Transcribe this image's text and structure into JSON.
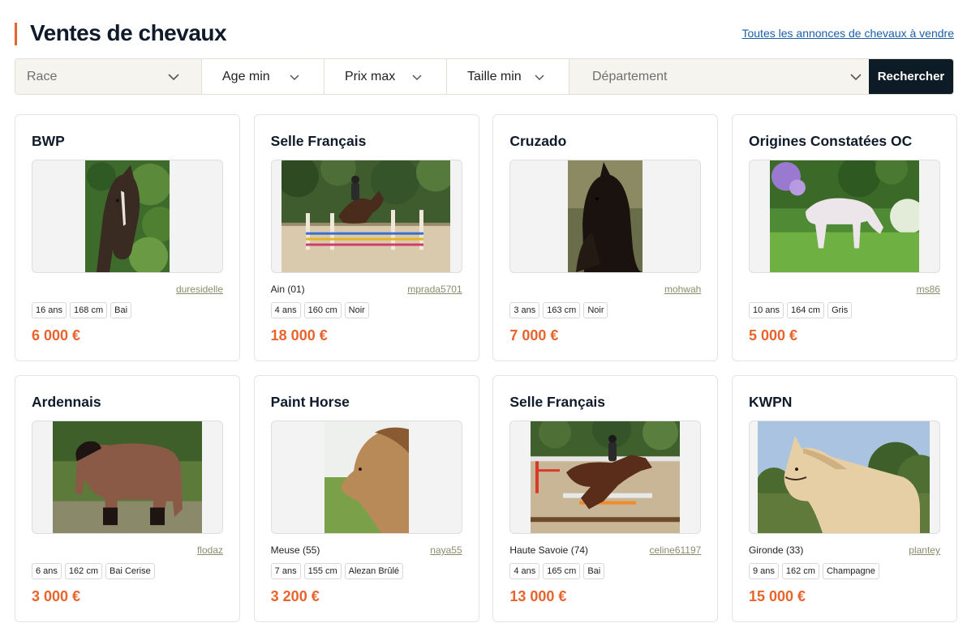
{
  "header": {
    "title": "Ventes de chevaux",
    "all_link": "Toutes les annonces de chevaux à vendre",
    "accent_color": "#e8642c"
  },
  "filters": {
    "race": "Race",
    "age_min": "Age min",
    "prix_max": "Prix max",
    "taille_min": "Taille min",
    "departement": "Département",
    "search_label": "Rechercher"
  },
  "listings": [
    {
      "breed": "BWP",
      "location": "",
      "seller": "duresidelle",
      "age": "16 ans",
      "height": "168 cm",
      "coat": "Bai",
      "price": "6 000 €"
    },
    {
      "breed": "Selle Français",
      "location": "Ain (01)",
      "seller": "mprada5701",
      "age": "4 ans",
      "height": "160 cm",
      "coat": "Noir",
      "price": "18 000 €"
    },
    {
      "breed": "Cruzado",
      "location": "",
      "seller": "mohwah",
      "age": "3 ans",
      "height": "163 cm",
      "coat": "Noir",
      "price": "7 000 €"
    },
    {
      "breed": "Origines Constatées OC",
      "location": "",
      "seller": "ms86",
      "age": "10 ans",
      "height": "164 cm",
      "coat": "Gris",
      "price": "5 000 €"
    },
    {
      "breed": "Ardennais",
      "location": "",
      "seller": "flodaz",
      "age": "6 ans",
      "height": "162 cm",
      "coat": "Bai Cerise",
      "price": "3 000 €"
    },
    {
      "breed": "Paint Horse",
      "location": "Meuse (55)",
      "seller": "naya55",
      "age": "7 ans",
      "height": "155 cm",
      "coat": "Alezan Brûlé",
      "price": "3 200 €"
    },
    {
      "breed": "Selle Français",
      "location": "Haute Savoie (74)",
      "seller": "celine61197",
      "age": "4 ans",
      "height": "165 cm",
      "coat": "Bai",
      "price": "13 000 €"
    },
    {
      "breed": "KWPN",
      "location": "Gironde (33)",
      "seller": "plantey",
      "age": "9 ans",
      "height": "162 cm",
      "coat": "Champagne",
      "price": "15 000 €"
    }
  ]
}
